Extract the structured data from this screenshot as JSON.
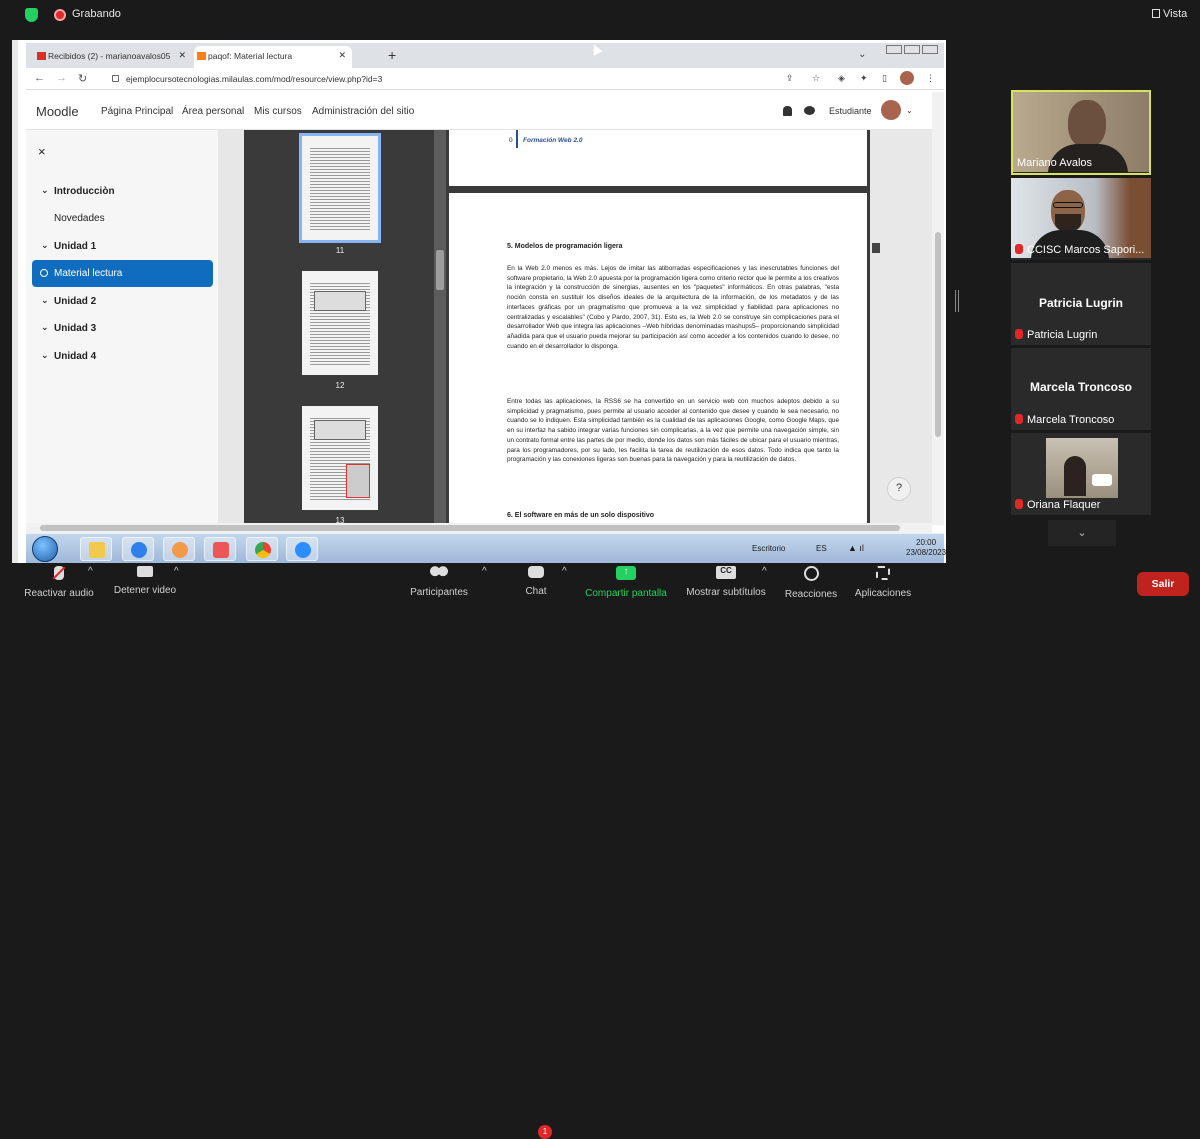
{
  "zoom_top": {
    "recording_label": "Grabando",
    "view_label": "Vista"
  },
  "browser": {
    "tabs": [
      {
        "label": "Recibidos (2) - marianoavalos05"
      },
      {
        "label": "paqof: Material lectura"
      }
    ],
    "url": "ejemplocursotecnologias.milaulas.com/mod/resource/view.php?id=3"
  },
  "moodle": {
    "logo": "Moodle",
    "nav": [
      "Página Principal",
      "Área personal",
      "Mis cursos",
      "Administración del sitio"
    ],
    "user_label": "Estudiante"
  },
  "sidebar": {
    "close": "×",
    "items": [
      {
        "label": "Introducciòn",
        "type": "section"
      },
      {
        "label": "Novedades",
        "type": "sub"
      },
      {
        "label": "Unidad 1",
        "type": "section"
      },
      {
        "label": "Material lectura",
        "type": "active"
      },
      {
        "label": "Unidad 2",
        "type": "section"
      },
      {
        "label": "Unidad 3",
        "type": "section"
      },
      {
        "label": "Unidad 4",
        "type": "section"
      }
    ]
  },
  "pdf": {
    "thumb_pages": [
      "11",
      "12",
      "13"
    ],
    "toc_item": "Formación Web 2.0",
    "toc_number": "0",
    "section_title": "5. Modelos de programación ligera",
    "para1": "En la Web 2.0 menos es más. Lejos de imitar las atiborradas especificaciones y las inescrutables funciones del software propietario, la Web 2.0 apuesta por la programación ligera como criterio rector que le permite a los creativos la integración y la construcción de sinergias, ausentes en los \"paquetes\" informáticos. En otras palabras, \"esta noción consta en sustituir los diseños ideales de la arquitectura de la información, de los metadatos y de las interfaces gráficas por un pragmatismo que promueva a la vez simplicidad y fiabilidad para aplicaciones no centralizadas y escalables\" (Cobo y Pardo, 2007, 31). Esto es, la Web 2.0 se construye sin complicaciones para el desarrollador Web que integra las aplicaciones –Web híbridas denominadas mashups5– proporcionando simplicidad añadida para que el usuario pueda mejorar su participación así como acceder a los contenidos cuando lo desee, no cuando en el desarrollador lo disponga.",
    "para2": "Entre todas las aplicaciones, la RSS6 se ha convertido en un servicio web con muchos adeptos debido a su simplicidad y pragmatismo, pues permite al usuario acceder al contenido que desee y cuando le sea necesario, no cuando se lo indiquen. Esta simplicidad también es la cualidad de las aplicaciones Google, como Google Maps, que en su interfaz ha sabido integrar varias funciones sin complicarlas, a la vez que permite una navegación simple, sin un contrato formal entre las partes de por medio, donde los datos son más fáciles de ubicar para el usuario mientras, para los programadores, por su lado, les facilita la tarea de reutilización de esos datos. Todo indica que tanto la programación y las conexiones ligeras son buenas para la navegación y para la reutilización de datos.",
    "next_section": "6. El software en más de un solo dispositivo",
    "help": "?"
  },
  "taskbar": {
    "desktop_label": "Escritorio",
    "lang": "ES",
    "time": "20:00",
    "date": "23/08/2023"
  },
  "participants": [
    {
      "name": "Mariano Avalos",
      "active": true
    },
    {
      "name": "CCISC Marcos Sapori...",
      "muted": true
    },
    {
      "display": "Patricia Lugrin",
      "name": "Patricia Lugrin",
      "muted": true
    },
    {
      "display": "Marcela Troncoso",
      "name": "Marcela Troncoso",
      "muted": true
    },
    {
      "name": "Oriana Flaquer",
      "muted": true
    }
  ],
  "zoom_controls": {
    "mute": "Reactivar audio",
    "video": "Detener video",
    "participants": "Participantes",
    "chat": "Chat",
    "chat_badge": "1",
    "share": "Compartir pantalla",
    "subtitles": "Mostrar subtítulos",
    "reactions": "Reacciones",
    "apps": "Aplicaciones",
    "leave": "Salir"
  },
  "colors": {
    "moodle_active": "#0f6cbf",
    "zoom_leave": "#c0221d",
    "active_speaker": "#d7e35d",
    "share_green": "#23d160"
  }
}
